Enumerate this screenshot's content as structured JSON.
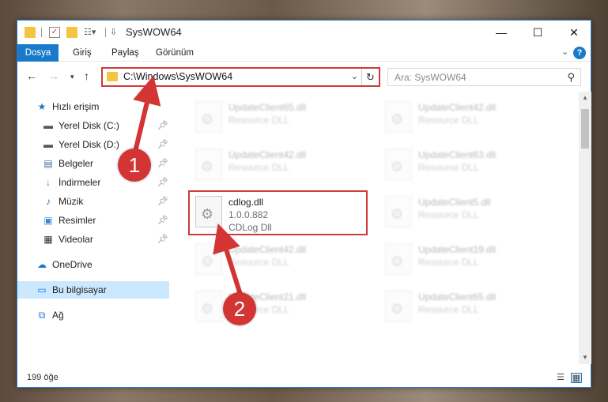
{
  "window": {
    "title": "SysWOW64",
    "controls": {
      "minimize": "—",
      "maximize": "☐",
      "close": "✕"
    }
  },
  "ribbon": {
    "tabs": [
      "Dosya",
      "Giriş",
      "Paylaş",
      "Görünüm"
    ]
  },
  "address_bar": {
    "path": "C:\\Windows\\SysWOW64",
    "search_placeholder": "Ara: SysWOW64"
  },
  "nav_pane": {
    "items": [
      {
        "label": "Hızlı erişim",
        "icon": "star-icon",
        "pinned": false
      },
      {
        "label": "Yerel Disk (C:)",
        "icon": "drive-icon",
        "pinned": true
      },
      {
        "label": "Yerel Disk (D:)",
        "icon": "drive-icon",
        "pinned": true
      },
      {
        "label": "Belgeler",
        "icon": "document-icon",
        "pinned": true
      },
      {
        "label": "İndirmeler",
        "icon": "download-icon",
        "pinned": true
      },
      {
        "label": "Müzik",
        "icon": "music-icon",
        "pinned": true
      },
      {
        "label": "Resimler",
        "icon": "pictures-icon",
        "pinned": true
      },
      {
        "label": "Videolar",
        "icon": "video-icon",
        "pinned": true
      },
      {
        "label": "OneDrive",
        "icon": "cloud-icon",
        "pinned": false
      },
      {
        "label": "Bu bilgisayar",
        "icon": "computer-icon",
        "pinned": false,
        "selected": true
      },
      {
        "label": "Ağ",
        "icon": "network-icon",
        "pinned": false
      }
    ]
  },
  "files": [
    {
      "name": "UpdateClient65.dll",
      "description": "Resource DLL"
    },
    {
      "name": "UpdateClient42.dll",
      "description": "Resource DLL"
    },
    {
      "name": "UpdateClient42.dll",
      "description": "Resource DLL"
    },
    {
      "name": "UpdateClient63.dll",
      "description": "Resource DLL"
    },
    {
      "name": "cdlog.dll",
      "version": "1.0.0.882",
      "description": "CDLog Dll",
      "highlighted": true
    },
    {
      "name": "UpdateClient5.dll",
      "description": "Resource DLL"
    },
    {
      "name": "UpdateClient42.dll",
      "description": "Resource DLL"
    },
    {
      "name": "UpdateClient19.dll",
      "description": "Resource DLL"
    },
    {
      "name": "UpdateClient21.dll",
      "description": "Resource DLL"
    },
    {
      "name": "UpdateClient65.dll",
      "description": "Resource DLL"
    }
  ],
  "status": {
    "item_count": "199 öğe"
  },
  "annotations": {
    "step1": "1",
    "step2": "2",
    "accent": "#d03a3a"
  }
}
